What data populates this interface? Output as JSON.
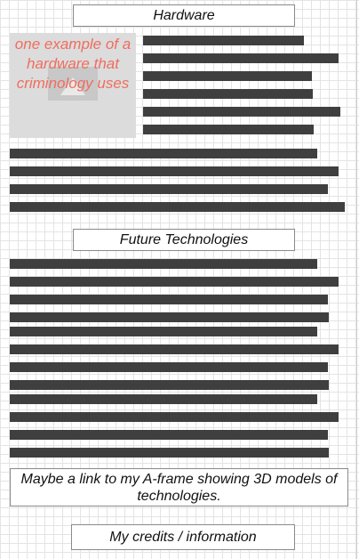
{
  "sections": {
    "hardware_title": "Hardware",
    "future_title": "Future Technologies",
    "credits_label": "My credits / information"
  },
  "image": {
    "caption": "one example of a hardware that criminology uses",
    "icon": "image-icon"
  },
  "link": {
    "text": "Maybe a link to my A-frame showing 3D models of technologies."
  },
  "colors": {
    "redacted_bar": "#3f3f3f",
    "caption": "#ef6d5f",
    "placeholder": "#dcdcdc",
    "grid_lines": "#e4e4e4"
  }
}
